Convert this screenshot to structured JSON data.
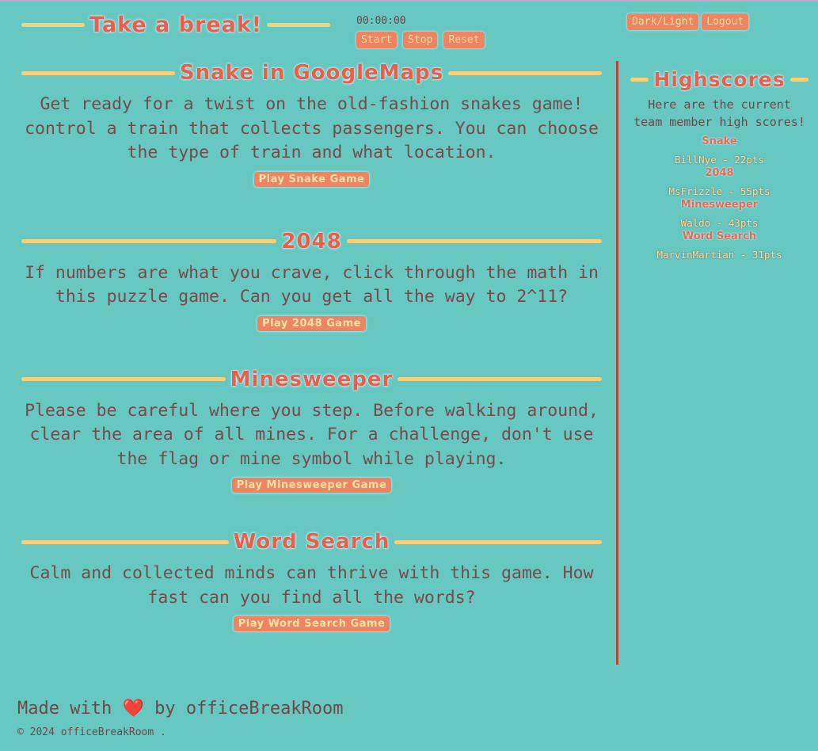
{
  "header": {
    "title": "Take a break!",
    "timer": "00:00:00",
    "start_label": "Start",
    "stop_label": "Stop",
    "reset_label": "Reset",
    "theme_label": "Dark/Light",
    "logout_label": "Logout"
  },
  "games": [
    {
      "title": "Snake in GoogleMaps",
      "description": "Get ready for a twist on the old-fashion snakes game! control a train that collects passengers. You can choose the type of train and what location.",
      "button": "Play Snake Game"
    },
    {
      "title": "2048",
      "description": "If numbers are what you crave, click through the math in this puzzle game. Can you get all the way to 2^11?",
      "button": "Play 2048 Game"
    },
    {
      "title": "Minesweeper",
      "description": "Please be careful where you step. Before walking around, clear the area of all mines. For a challenge, don't use the flag or mine symbol while playing.",
      "button": "Play Minesweeper Game"
    },
    {
      "title": "Word Search",
      "description": "Calm and collected minds can thrive with this game. How fast can you find all the words?",
      "button": "Play Word Search Game"
    }
  ],
  "highscores": {
    "title": "Highscores",
    "intro": "Here are the current team member high scores!",
    "entries": [
      {
        "game": "Snake",
        "score": "BillNye - 22pts"
      },
      {
        "game": "2048",
        "score": "MsFrizzle - 55pts"
      },
      {
        "game": "Minesweeper",
        "score": "Waldo - 43pts"
      },
      {
        "game": "Word Search",
        "score": "MarvinMartian - 31pts"
      }
    ]
  },
  "footer": {
    "made_prefix": "Made with",
    "heart": "❤️",
    "made_suffix": "by officeBreakRoom",
    "copyright": "© 2024 officeBreakRoom ."
  },
  "colors": {
    "background": "#67c8c1",
    "accent_orange": "#ef8463",
    "title_red": "#e46051",
    "rule_yellow": "#f5d27a",
    "divider": "#b8453a"
  }
}
